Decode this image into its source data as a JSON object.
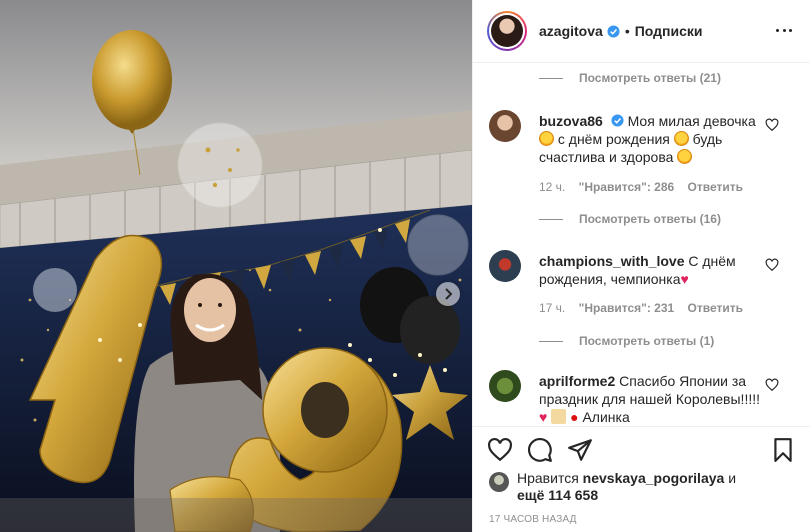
{
  "header": {
    "username": "azagitova",
    "separator": "•",
    "follow_label": "Подписки"
  },
  "comments_section": {
    "view_replies_top": "Посмотреть ответы (21)",
    "comments": [
      {
        "username": "buzova86",
        "verified": true,
        "text_part1": "Моя милая девочка",
        "text_part2": "с днём рождения",
        "text_part3": "будь счастлива и здорова",
        "time": "12 ч.",
        "likes": "\"Нравится\": 286",
        "reply_label": "Ответить",
        "view_replies": "Посмотреть ответы (16)"
      },
      {
        "username": "champions_with_love",
        "text": "С днём рождения, чемпионка",
        "time": "17 ч.",
        "likes": "\"Нравится\": 231",
        "reply_label": "Ответить",
        "view_replies": "Посмотреть ответы (1)"
      },
      {
        "username": "aprilforme2",
        "text_part1": "Спасибо Японии за праздник для нашей Королевы!!!!!",
        "text_part2": "Алинка"
      }
    ]
  },
  "likes": {
    "prefix": "Нравится",
    "user": "nevskaya_pogorilaya",
    "conjunction": "и",
    "others": "ещё 114 658"
  },
  "timestamp": "17 ЧАСОВ НАЗАД",
  "photo": {
    "balloon_number": "19",
    "balloon_color": "#d8b04a"
  },
  "colors": {
    "verified": "#3897f0",
    "link_gray": "#8e8e8e",
    "heart_red": "#e0245e"
  },
  "icons": {
    "like": "heart-icon",
    "comment": "comment-bubble-icon",
    "share": "paper-plane-icon",
    "save": "bookmark-icon",
    "more": "more-options-icon",
    "next": "chevron-right-icon"
  }
}
